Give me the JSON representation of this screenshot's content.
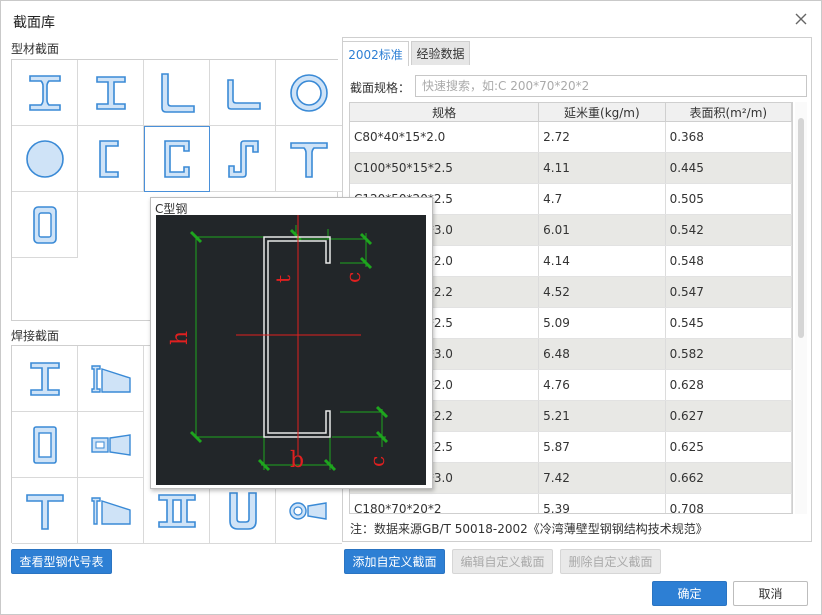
{
  "dialog": {
    "title": "截面库"
  },
  "left": {
    "profiles_label": "型材截面",
    "welded_label": "焊接截面",
    "view_codes_button": "查看型钢代号表"
  },
  "tooltip": {
    "title": "C型钢",
    "labels": {
      "h": "h",
      "t": "t",
      "b": "b",
      "c1": "c",
      "c2": "c"
    }
  },
  "tabs": [
    {
      "label": "2002标准"
    },
    {
      "label": "经验数据"
    }
  ],
  "search": {
    "label": "截面规格：",
    "placeholder": "快速搜索，如:C 200*70*20*2"
  },
  "table": {
    "headers": [
      "规格",
      "延米重(kg/m)",
      "表面积(m²/m)"
    ],
    "rows": [
      [
        "C80*40*15*2.0",
        "2.72",
        "0.368"
      ],
      [
        "C100*50*15*2.5",
        "4.11",
        "0.445"
      ],
      [
        "C120*50*20*2.5",
        "4.7",
        "0.505"
      ],
      [
        "C120*60*20*3.0",
        "6.01",
        "0.542"
      ],
      [
        "C140*50*20*2.0",
        "4.14",
        "0.548"
      ],
      [
        "C140*50*20*2.2",
        "4.52",
        "0.547"
      ],
      [
        "C140*50*20*2.5",
        "5.09",
        "0.545"
      ],
      [
        "C140*60*20*3.0",
        "6.48",
        "0.582"
      ],
      [
        "C160*60*20*2.0",
        "4.76",
        "0.628"
      ],
      [
        "C160*60*20*2.2",
        "5.21",
        "0.627"
      ],
      [
        "C160*60*20*2.5",
        "5.87",
        "0.625"
      ],
      [
        "C160*70*20*3.0",
        "7.42",
        "0.662"
      ],
      [
        "C180*70*20*2",
        "5.39",
        "0.708"
      ]
    ]
  },
  "note": "注：数据来源GB/T 50018-2002《冷湾薄壁型钢钢结构技术规范》",
  "actions": {
    "add": "添加自定义截面",
    "edit": "编辑自定义截面",
    "delete": "删除自定义截面"
  },
  "footer": {
    "ok": "确定",
    "cancel": "取消"
  },
  "colors": {
    "accent": "#2d7fd4",
    "shape_fill": "#cfe3f7",
    "shape_stroke": "#3a8ad6"
  }
}
